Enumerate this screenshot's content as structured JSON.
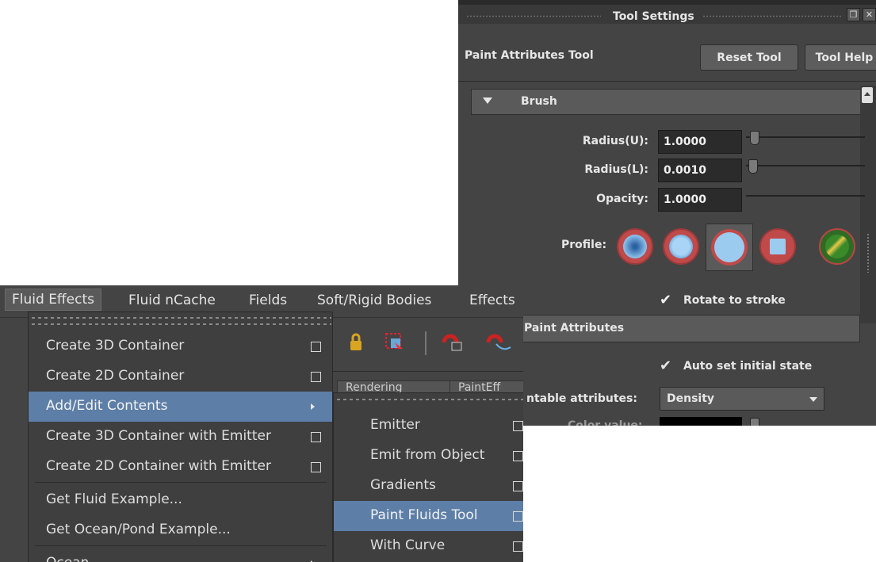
{
  "tool_settings": {
    "title": "Tool Settings",
    "tool_name": "Paint Attributes Tool",
    "reset_button": "Reset Tool",
    "help_button": "Tool Help",
    "brush_section": "Brush",
    "radius_u_label": "Radius(U):",
    "radius_u_value": "1.0000",
    "radius_l_label": "Radius(L):",
    "radius_l_value": "0.0010",
    "opacity_label": "Opacity:",
    "opacity_value": "1.0000",
    "profile_label": "Profile:",
    "rotate_label": "Rotate to stroke",
    "paint_attributes_section": "Paint Attributes",
    "auto_set_label": "Auto set initial state",
    "paintable_label": "ntable attributes:",
    "paintable_value": "Density",
    "color_value_label": "Color value:"
  },
  "menubar": {
    "items": [
      "Fluid Effects",
      "Fluid nCache",
      "Fields",
      "Soft/Rigid Bodies",
      "Effects"
    ]
  },
  "main_menu": {
    "items": [
      "Create 3D Container",
      "Create 2D Container",
      "Add/Edit Contents",
      "Create 3D Container with Emitter",
      "Create 2D Container with Emitter",
      "Get Fluid Example...",
      "Get Ocean/Pond Example...",
      "Ocean"
    ]
  },
  "submenu": {
    "items": [
      "Emitter",
      "Emit from Object",
      "Gradients",
      "Paint Fluids Tool",
      "With Curve"
    ]
  },
  "shelf_tabs": [
    "Rendering",
    "PaintEff"
  ],
  "colors": {
    "panel_bg": "#444444",
    "highlight": "#5d7fa7"
  }
}
